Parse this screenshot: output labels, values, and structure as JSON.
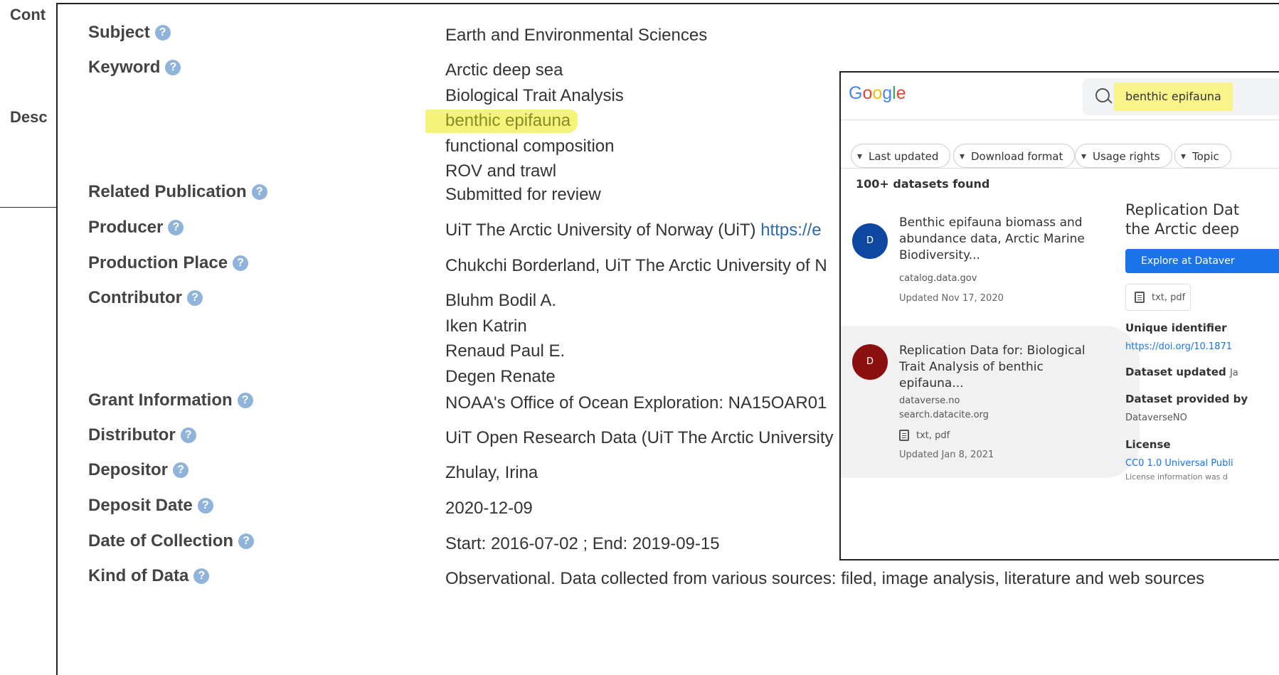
{
  "background_labels": [
    "Cont",
    "Desc"
  ],
  "fields": [
    {
      "label": "Subject",
      "values": [
        "Earth and Environmental Sciences"
      ]
    },
    {
      "label": "Keyword",
      "values": [
        "Arctic deep sea",
        "Biological Trait Analysis",
        "benthic epifauna",
        "functional composition",
        "ROV and trawl"
      ],
      "highlighted": "benthic epifauna"
    },
    {
      "label": "Related Publication",
      "values": [
        "Submitted for review"
      ]
    },
    {
      "label": "Producer",
      "values": [
        "UiT The Arctic University of Norway (UiT)"
      ],
      "link": "https://e"
    },
    {
      "label": "Production Place",
      "values": [
        "Chukchi Borderland, UiT The Arctic University of N"
      ]
    },
    {
      "label": "Contributor",
      "values": [
        "Bluhm Bodil A.",
        "Iken Katrin",
        "Renaud Paul E.",
        "Degen Renate"
      ]
    },
    {
      "label": "Grant Information",
      "values": [
        "NOAA's Office of Ocean Exploration: NA15OAR01"
      ]
    },
    {
      "label": "Distributor",
      "values": [
        "UiT Open Research Data (UiT The Arctic University"
      ]
    },
    {
      "label": "Depositor",
      "values": [
        "Zhulay, Irina"
      ]
    },
    {
      "label": "Deposit Date",
      "values": [
        "2020-12-09"
      ]
    },
    {
      "label": "Date of Collection",
      "values": [
        "Start: 2016-07-02 ; End: 2019-09-15"
      ]
    },
    {
      "label": "Kind of Data",
      "values": [
        "Observational. Data collected from various sources: filed, image analysis, literature and web sources"
      ]
    }
  ],
  "google": {
    "logo": "Google",
    "query": "benthic epifauna",
    "filters": [
      "Last updated",
      "Download format",
      "Usage rights",
      "Topic"
    ],
    "results_count": "100+ datasets found",
    "results": [
      {
        "avatar": "D",
        "avatar_color": "#0d47a1",
        "title": "Benthic epifauna biomass and abundance data, Arctic Marine Biodiversity...",
        "sources": [
          "catalog.data.gov"
        ],
        "formats": "",
        "updated": "Updated Nov 17, 2020"
      },
      {
        "avatar": "D",
        "avatar_color": "#8b0f0f",
        "title": "Replication Data for: Biological Trait Analysis of benthic epifauna...",
        "sources": [
          "dataverse.no",
          "search.datacite.org"
        ],
        "formats": "txt, pdf",
        "updated": "Updated Jan 8, 2021"
      }
    ],
    "detail": {
      "title_line1": "Replication Dat",
      "title_line2": "the Arctic deep",
      "explore_button": "Explore at Dataver",
      "formats": "txt, pdf",
      "unique_identifier_label": "Unique identifier",
      "unique_identifier_value": "https://doi.org/10.1871",
      "dataset_updated_label": "Dataset updated",
      "dataset_updated_value": "Ja",
      "provided_by_label": "Dataset provided by",
      "provided_by_value": "DataverseNO",
      "license_label": "License",
      "license_value": "CC0 1.0 Universal Publi",
      "license_note": "License information was d"
    }
  }
}
